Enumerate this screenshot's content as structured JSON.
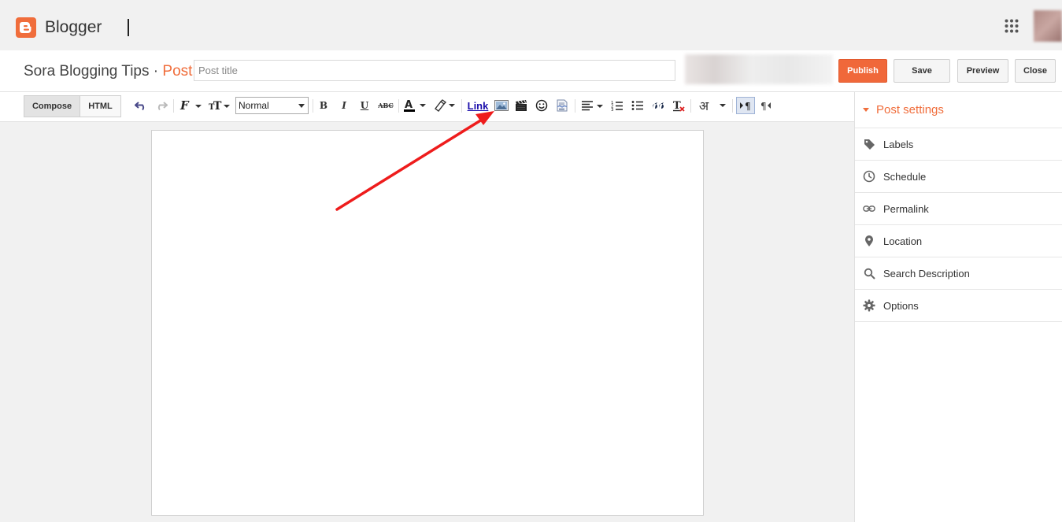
{
  "app": {
    "brand": "Blogger",
    "accent_color": "#f06d3b"
  },
  "header": {
    "blog_name": "Sora Blogging Tips",
    "separator": "·",
    "section": "Post",
    "title_placeholder": "Post title",
    "title_value": "",
    "buttons": {
      "publish": "Publish",
      "save": "Save",
      "preview": "Preview",
      "close": "Close"
    }
  },
  "toolbar": {
    "modes": {
      "compose": "Compose",
      "html": "HTML"
    },
    "format_select": "Normal",
    "link_label": "Link",
    "icons": [
      "undo-icon",
      "redo-icon",
      "font-family-icon",
      "font-size-icon",
      "bold-icon",
      "italic-icon",
      "underline-icon",
      "strikethrough-icon",
      "text-color-icon",
      "highlight-color-icon",
      "insert-image-icon",
      "insert-video-icon",
      "insert-emoji-icon",
      "insert-jump-break-icon",
      "align-icon",
      "numbered-list-icon",
      "bulleted-list-icon",
      "quote-icon",
      "remove-formatting-icon",
      "input-tools-icon",
      "ltr-icon",
      "rtl-icon"
    ],
    "glyphs": {
      "bold": "B",
      "italic": "I",
      "underline": "U",
      "strike": "ABC",
      "text_color": "A",
      "ltr": "¶",
      "rtl": "¶",
      "input_tools": "अ"
    }
  },
  "sidebar": {
    "heading": "Post settings",
    "items": [
      {
        "label": "Labels",
        "icon": "tag-icon"
      },
      {
        "label": "Schedule",
        "icon": "clock-icon"
      },
      {
        "label": "Permalink",
        "icon": "link-icon"
      },
      {
        "label": "Location",
        "icon": "pin-icon"
      },
      {
        "label": "Search Description",
        "icon": "search-icon"
      },
      {
        "label": "Options",
        "icon": "gear-icon"
      }
    ]
  },
  "annotation": {
    "arrow_color": "#ee1c1c",
    "target": "insert-image-icon"
  }
}
